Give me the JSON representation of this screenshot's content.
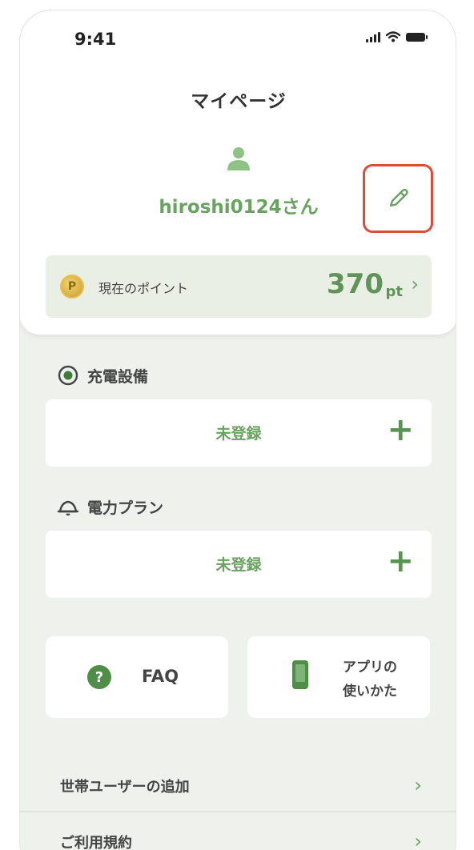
{
  "status_bar": {
    "time": "9:41"
  },
  "header": {
    "title": "マイページ"
  },
  "profile": {
    "username": "hiroshi0124さん"
  },
  "points": {
    "coin_symbol": "P",
    "label": "現在のポイント",
    "value": "370",
    "unit": "pt",
    "chevron": "›"
  },
  "sections": {
    "charging": {
      "title": "充電設備",
      "status": "未登録",
      "add": "+"
    },
    "plan": {
      "title": "電力プラン",
      "status": "未登録",
      "add": "+"
    }
  },
  "tiles": {
    "faq": {
      "icon_symbol": "?",
      "label": "FAQ"
    },
    "guide": {
      "line1": "アプリの",
      "line2": "使いかた"
    }
  },
  "list": [
    {
      "label": "世帯ユーザーの追加",
      "chevron": "›"
    },
    {
      "label": "ご利用規約",
      "chevron": "›"
    }
  ],
  "colors": {
    "accent": "#6aa262",
    "highlight_border": "#e04a3c",
    "background": "#eef1ec"
  },
  "icons": [
    "user-icon",
    "pencil-icon",
    "coin-icon",
    "charger-icon",
    "plan-icon",
    "question-icon",
    "smartphone-icon",
    "chevron-right-icon"
  ]
}
